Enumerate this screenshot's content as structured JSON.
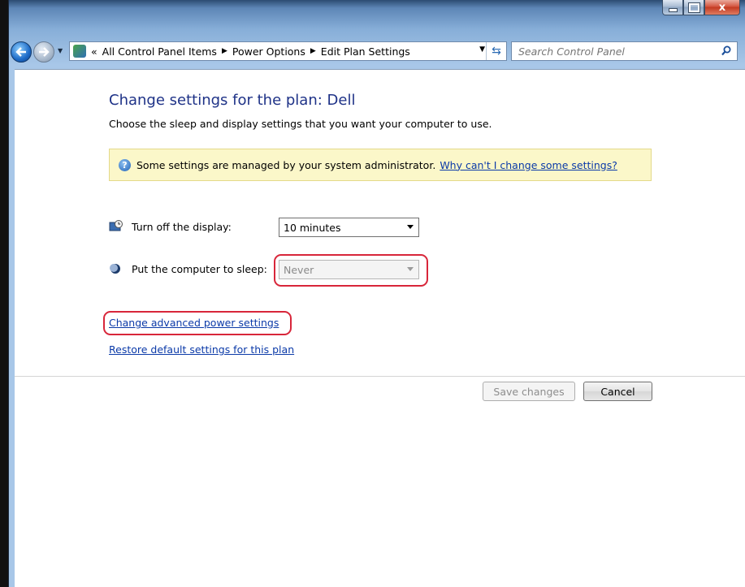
{
  "window": {
    "minimize_glyph": "▁",
    "maximize_glyph": "□",
    "close_glyph": "x"
  },
  "address_bar": {
    "prefix": "«",
    "crumbs": [
      "All Control Panel Items",
      "Power Options",
      "Edit Plan Settings"
    ],
    "separator": "▶"
  },
  "search": {
    "placeholder": "Search Control Panel"
  },
  "page": {
    "title": "Change settings for the plan: Dell",
    "subtitle": "Choose the sleep and display settings that you want your computer to use."
  },
  "info_bar": {
    "text": "Some settings are managed by your system administrator.",
    "link": "Why can't I change some settings?"
  },
  "settings": {
    "display_label": "Turn off the display:",
    "display_value": "10 minutes",
    "sleep_label": "Put the computer to sleep:",
    "sleep_value": "Never"
  },
  "links": {
    "advanced": "Change advanced power settings",
    "restore": "Restore default settings for this plan"
  },
  "buttons": {
    "save": "Save changes",
    "cancel": "Cancel"
  },
  "colors": {
    "title": "#1e3287",
    "link": "#0b3aa8",
    "highlight": "#d8263a",
    "info_bg": "#fbf7c9"
  }
}
